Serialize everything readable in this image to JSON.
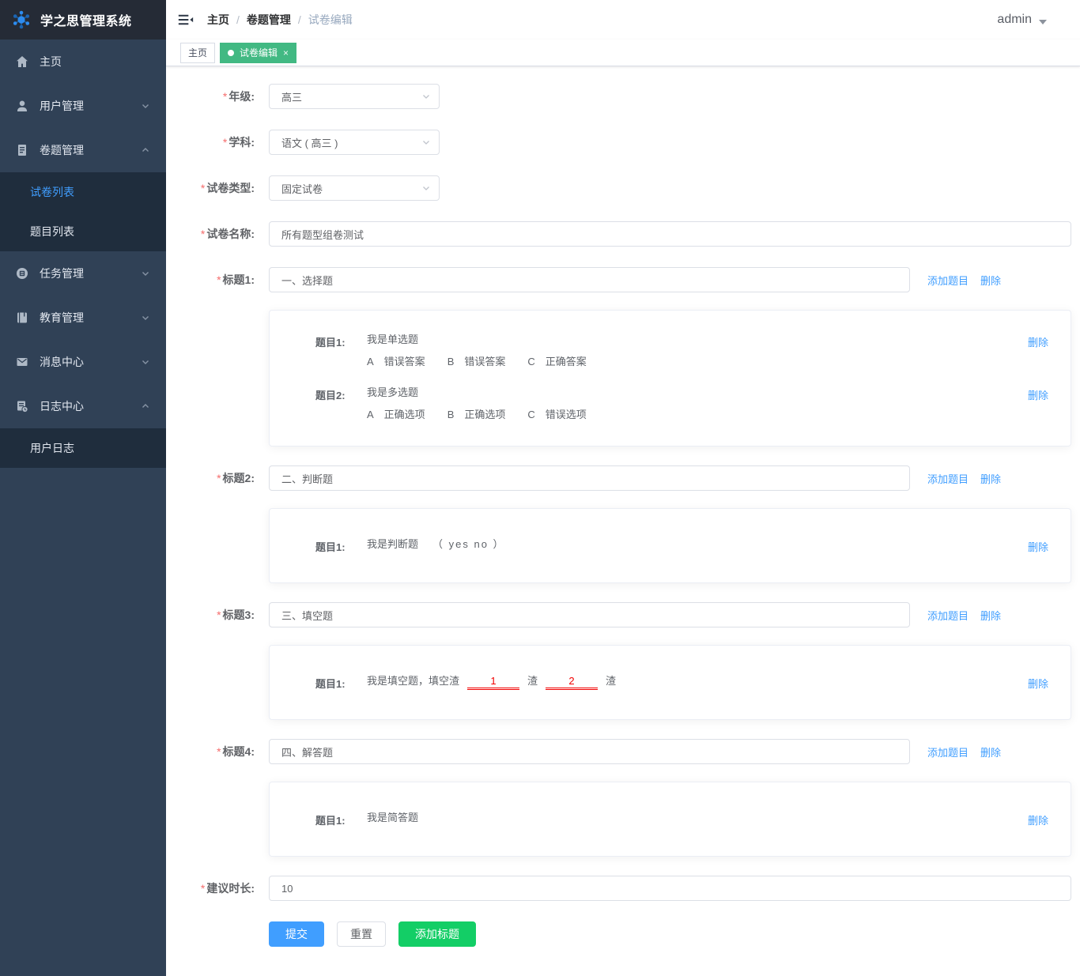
{
  "app": {
    "title": "学之思管理系统"
  },
  "header": {
    "breadcrumb": {
      "items": [
        "主页",
        "卷题管理",
        "试卷编辑"
      ],
      "separator": "/"
    },
    "user": "admin"
  },
  "tabs": {
    "items": [
      {
        "label": "主页",
        "active": false
      },
      {
        "label": "试卷编辑",
        "active": true
      }
    ],
    "close_glyph": "×"
  },
  "sidebar": {
    "items": [
      {
        "label": "主页",
        "icon": "home-icon"
      },
      {
        "label": "用户管理",
        "icon": "user-icon",
        "chevron": "down"
      },
      {
        "label": "卷题管理",
        "icon": "exam-paper-icon",
        "chevron": "up",
        "children": [
          {
            "label": "试卷列表",
            "active": true
          },
          {
            "label": "题目列表",
            "active": false
          }
        ]
      },
      {
        "label": "任务管理",
        "icon": "task-icon",
        "chevron": "down"
      },
      {
        "label": "教育管理",
        "icon": "education-icon",
        "chevron": "down"
      },
      {
        "label": "消息中心",
        "icon": "message-icon",
        "chevron": "down"
      },
      {
        "label": "日志中心",
        "icon": "log-icon",
        "chevron": "up",
        "children": [
          {
            "label": "用户日志",
            "active": false
          }
        ]
      }
    ]
  },
  "form": {
    "required_mark": "*",
    "grade": {
      "label": "年级:",
      "value": "高三"
    },
    "subject": {
      "label": "学科:",
      "value": "语文 ( 高三 )"
    },
    "type": {
      "label": "试卷类型:",
      "value": "固定试卷"
    },
    "name": {
      "label": "试卷名称:",
      "value": "所有题型组卷测试"
    },
    "duration": {
      "label": "建议时长:",
      "value": "10"
    },
    "actions": {
      "add_question": "添加题目",
      "delete": "删除"
    },
    "sections": [
      {
        "label": "标题1:",
        "title": "一、选择题",
        "questions": [
          {
            "label": "题目1:",
            "text": "我是单选题",
            "options": [
              {
                "tag": "A",
                "text": "错误答案"
              },
              {
                "tag": "B",
                "text": "错误答案"
              },
              {
                "tag": "C",
                "text": "正确答案"
              }
            ]
          },
          {
            "label": "题目2:",
            "text": "我是多选题",
            "options": [
              {
                "tag": "A",
                "text": "正确选项"
              },
              {
                "tag": "B",
                "text": "正确选项"
              },
              {
                "tag": "C",
                "text": "错误选项"
              }
            ]
          }
        ]
      },
      {
        "label": "标题2:",
        "title": "二、判断题",
        "questions": [
          {
            "label": "题目1:",
            "text": "我是判断题",
            "suffix": "（ yes  no ）"
          }
        ]
      },
      {
        "label": "标题3:",
        "title": "三、填空题",
        "questions": [
          {
            "label": "题目1:",
            "text": "我是填空题，填空渣",
            "blank1": "1",
            "mid": "渣",
            "blank2": "2",
            "tail": "渣"
          }
        ]
      },
      {
        "label": "标题4:",
        "title": "四、解答题",
        "questions": [
          {
            "label": "题目1:",
            "text": "我是简答题"
          }
        ]
      }
    ],
    "buttons": {
      "submit": "提交",
      "reset": "重置",
      "add_title": "添加标题"
    }
  },
  "colors": {
    "accent": "#409eff",
    "tab_active": "#42b983",
    "success": "#13ce66",
    "required": "#f56c6c",
    "blank_red": "#f20000",
    "sidebar_bg": "#304156",
    "submenu_bg": "#1f2d3d",
    "logo_bg": "#252b36"
  }
}
